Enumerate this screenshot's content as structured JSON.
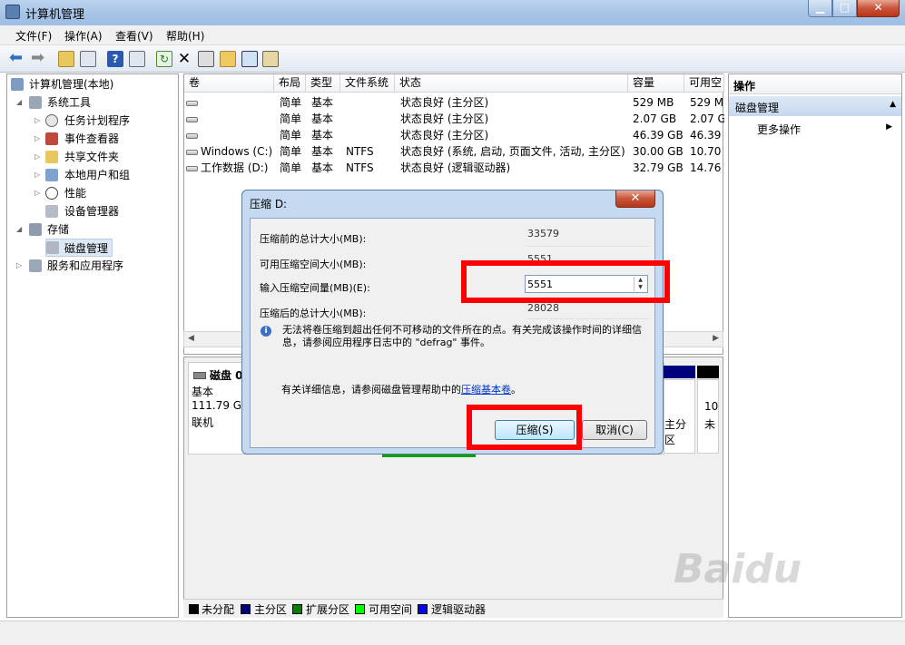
{
  "window": {
    "title": "计算机管理",
    "min": "▁",
    "max": "□",
    "close": "✕"
  },
  "menu": [
    {
      "label": "文件(F)"
    },
    {
      "label": "操作(A)"
    },
    {
      "label": "查看(V)"
    },
    {
      "label": "帮助(H)"
    }
  ],
  "tree": {
    "root": "计算机管理(本地)",
    "system_tools": "系统工具",
    "task_scheduler": "任务计划程序",
    "event_viewer": "事件查看器",
    "shared_folders": "共享文件夹",
    "local_users": "本地用户和组",
    "performance": "性能",
    "device_manager": "设备管理器",
    "storage": "存储",
    "disk_management": "磁盘管理",
    "services_apps": "服务和应用程序"
  },
  "volumes": {
    "headers": [
      "卷",
      "布局",
      "类型",
      "文件系统",
      "状态",
      "容量",
      "可用空"
    ],
    "rows": [
      {
        "name": "",
        "layout": "简单",
        "type": "基本",
        "fs": "",
        "status": "状态良好 (主分区)",
        "capacity": "529 MB",
        "free": "529 M"
      },
      {
        "name": "",
        "layout": "简单",
        "type": "基本",
        "fs": "",
        "status": "状态良好 (主分区)",
        "capacity": "2.07 GB",
        "free": "2.07 G"
      },
      {
        "name": "",
        "layout": "简单",
        "type": "基本",
        "fs": "",
        "status": "状态良好 (主分区)",
        "capacity": "46.39 GB",
        "free": "46.39"
      },
      {
        "name": "Windows (C:)",
        "layout": "简单",
        "type": "基本",
        "fs": "NTFS",
        "status": "状态良好 (系统, 启动, 页面文件, 活动, 主分区)",
        "capacity": "30.00 GB",
        "free": "10.70"
      },
      {
        "name": "工作数据 (D:)",
        "layout": "简单",
        "type": "基本",
        "fs": "NTFS",
        "status": "状态良好 (逻辑驱动器)",
        "capacity": "32.79 GB",
        "free": "14.76"
      }
    ]
  },
  "disk": {
    "name": "磁盘 0",
    "type": "基本",
    "size": "111.79 GB",
    "state": "联机",
    "part_fragment_1": "主分区",
    "part_fragment_2a": "10",
    "part_fragment_2b": "未"
  },
  "legend": [
    {
      "label": "未分配",
      "color": "#000000"
    },
    {
      "label": "主分区",
      "color": "#00007f"
    },
    {
      "label": "扩展分区",
      "color": "#007f00"
    },
    {
      "label": "可用空间",
      "color": "#00ff00"
    },
    {
      "label": "逻辑驱动器",
      "color": "#0000ff"
    }
  ],
  "actions": {
    "header": "操作",
    "section": "磁盘管理",
    "more": "更多操作"
  },
  "dialog": {
    "title": "压缩 D:",
    "close": "✕",
    "total_before_label": "压缩前的总计大小(MB):",
    "total_before_value": "33579",
    "available_label": "可用压缩空间大小(MB):",
    "available_value": "5551",
    "input_label": "输入压缩空间量(MB)(E):",
    "input_value": "5551",
    "total_after_label": "压缩后的总计大小(MB):",
    "total_after_value": "28028",
    "info_text": "无法将卷压缩到超出任何不可移动的文件所在的点。有关完成该操作时间的详细信息，请参阅应用程序日志中的 \"defrag\" 事件。",
    "help_prefix": "有关详细信息，请参阅磁盘管理帮助中的",
    "help_link": "压缩基本卷",
    "help_suffix": "。",
    "shrink_button": "压缩(S)",
    "cancel_button": "取消(C)"
  }
}
